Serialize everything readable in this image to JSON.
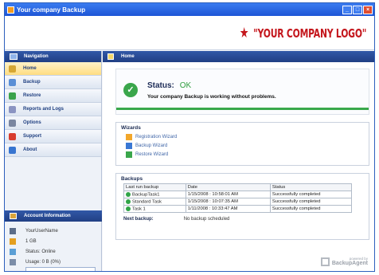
{
  "window": {
    "title": "Your company Backup",
    "buttons": {
      "minimize": "_",
      "maximize": "□",
      "close": "×"
    }
  },
  "banner": {
    "logo_text": "\"YOUR COMPANY LOGO\"",
    "logo_icon": "star-icon"
  },
  "sidebar": {
    "header": "Navigation",
    "items": [
      {
        "label": "Home",
        "icon": "home-icon",
        "color": "#d6a734",
        "active": true
      },
      {
        "label": "Backup",
        "icon": "backup-icon",
        "color": "#5a8fd6",
        "active": false
      },
      {
        "label": "Restore",
        "icon": "restore-icon",
        "color": "#3ba34c",
        "active": false
      },
      {
        "label": "Reports and Logs",
        "icon": "reports-icon",
        "color": "#8b94c2",
        "active": false
      },
      {
        "label": "Options",
        "icon": "options-icon",
        "color": "#7a86a0",
        "active": false
      },
      {
        "label": "Support",
        "icon": "support-icon",
        "color": "#d83c2f",
        "active": false
      },
      {
        "label": "About",
        "icon": "about-icon",
        "color": "#3875d0",
        "active": false
      }
    ]
  },
  "account": {
    "header": "Account Information",
    "rows": [
      {
        "label": "YourUserName",
        "icon": "user-icon",
        "color": "#5c6d89"
      },
      {
        "label": "1 GB",
        "icon": "storage-icon",
        "color": "#e49f1f"
      },
      {
        "label": "Status: Online",
        "icon": "status-icon",
        "color": "#5b9fd5"
      },
      {
        "label": "Usage: 0 B (0%)",
        "icon": "usage-icon",
        "color": "#7b8da8"
      }
    ],
    "usage_percent": 0
  },
  "main": {
    "header": "Home",
    "status": {
      "label": "Status:",
      "value": "OK",
      "message": "Your company Backup is working without problems."
    },
    "wizards": {
      "title": "Wizards",
      "items": [
        {
          "label": "Registration Wizard",
          "icon": "registration-wizard-icon",
          "color": "#f2a72b"
        },
        {
          "label": "Backup Wizard",
          "icon": "backup-wizard-icon",
          "color": "#3a78d4"
        },
        {
          "label": "Restore Wizard",
          "icon": "restore-wizard-icon",
          "color": "#3aa64b"
        }
      ]
    },
    "backups": {
      "title": "Backups",
      "columns": [
        "Last run backup",
        "Date",
        "Status"
      ],
      "rows": [
        {
          "name": "BackupTask1",
          "date": "1/15/2008 : 10:58:01 AM",
          "status": "Successfully completed"
        },
        {
          "name": "Standard Task",
          "date": "1/15/2008 : 10:07:35 AM",
          "status": "Successfully completed"
        },
        {
          "name": "Task 1",
          "date": "1/11/2008 : 10:33:47 AM",
          "status": "Successfully completed"
        }
      ],
      "next_label": "Next backup:",
      "next_value": "No backup scheduled"
    },
    "powered_by": {
      "text": "powered by",
      "brand": "BackupAgent"
    }
  },
  "colors": {
    "accent": "#2f61c4",
    "logo": "#c4161c",
    "ok": "#2f9e3f"
  }
}
